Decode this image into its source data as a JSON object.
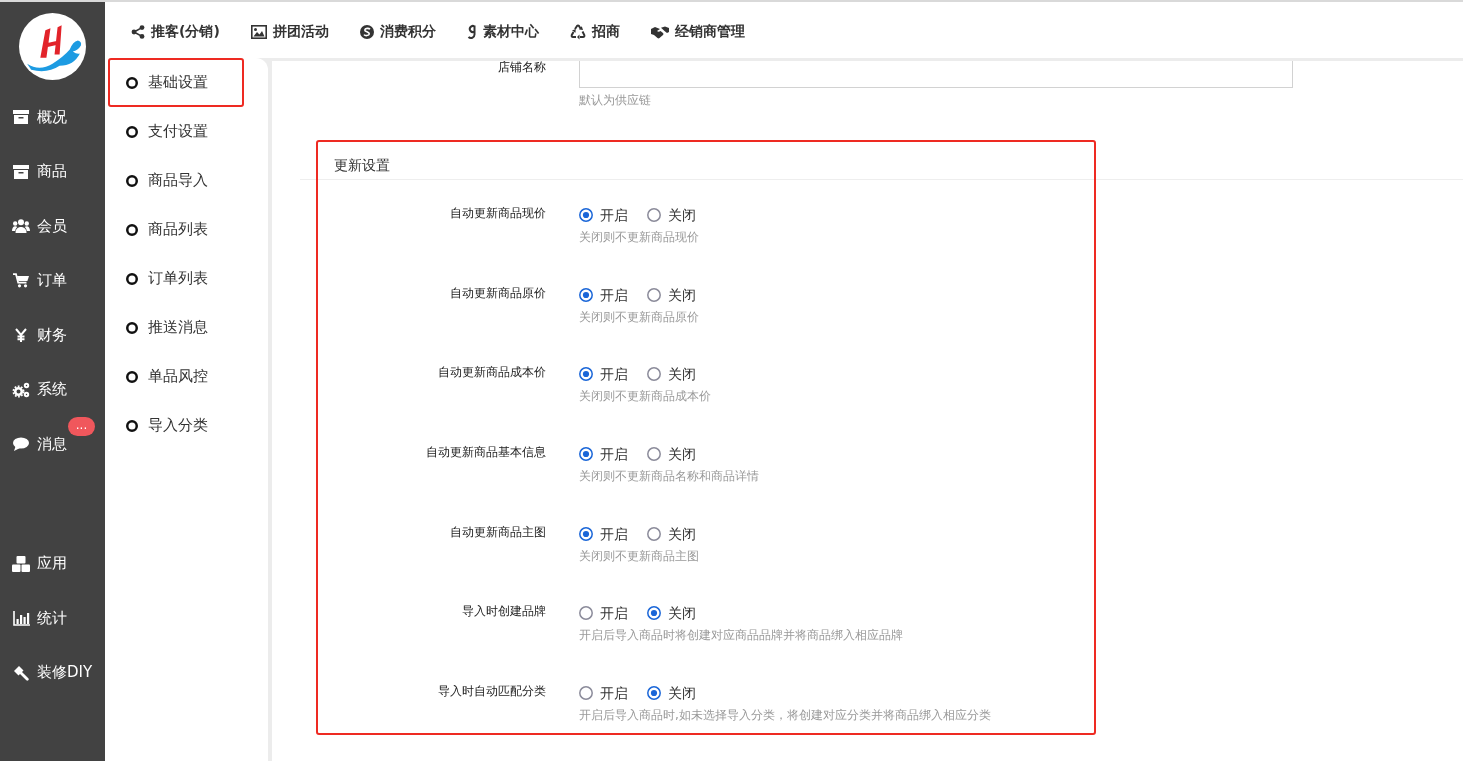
{
  "sidebar": {
    "main_items": [
      {
        "label": "概况"
      },
      {
        "label": "商品"
      },
      {
        "label": "会员"
      },
      {
        "label": "订单"
      },
      {
        "label": "财务"
      },
      {
        "label": "系统"
      },
      {
        "label": "消息",
        "badge": "..."
      }
    ],
    "bottom_items": [
      {
        "label": "应用"
      },
      {
        "label": "统计"
      },
      {
        "label": "装修DIY"
      }
    ]
  },
  "top_nav": [
    {
      "label": "推客(分销)"
    },
    {
      "label": "拼团活动"
    },
    {
      "label": "消费积分"
    },
    {
      "label": "素材中心"
    },
    {
      "label": "招商"
    },
    {
      "label": "经销商管理"
    }
  ],
  "sub_menu": [
    {
      "label": "基础设置",
      "selected": true
    },
    {
      "label": "支付设置",
      "selected": false
    },
    {
      "label": "商品导入",
      "selected": false
    },
    {
      "label": "商品列表",
      "selected": false
    },
    {
      "label": "订单列表",
      "selected": false
    },
    {
      "label": "推送消息",
      "selected": false
    },
    {
      "label": "单品风控",
      "selected": false
    },
    {
      "label": "导入分类",
      "selected": false
    }
  ],
  "store_name": {
    "label": "店铺名称",
    "hint": "默认为供应链"
  },
  "update_section": {
    "title": "更新设置",
    "highlighted": true,
    "rows": [
      {
        "label": "自动更新商品现价",
        "options": [
          {
            "label": "开启",
            "selected": true
          },
          {
            "label": "关闭",
            "selected": false
          }
        ],
        "hint": "关闭则不更新商品现价"
      },
      {
        "label": "自动更新商品原价",
        "options": [
          {
            "label": "开启",
            "selected": true
          },
          {
            "label": "关闭",
            "selected": false
          }
        ],
        "hint": "关闭则不更新商品原价"
      },
      {
        "label": "自动更新商品成本价",
        "options": [
          {
            "label": "开启",
            "selected": true
          },
          {
            "label": "关闭",
            "selected": false
          }
        ],
        "hint": "关闭则不更新商品成本价"
      },
      {
        "label": "自动更新商品基本信息",
        "options": [
          {
            "label": "开启",
            "selected": true
          },
          {
            "label": "关闭",
            "selected": false
          }
        ],
        "hint": "关闭则不更新商品名称和商品详情"
      },
      {
        "label": "自动更新商品主图",
        "options": [
          {
            "label": "开启",
            "selected": true
          },
          {
            "label": "关闭",
            "selected": false
          }
        ],
        "hint": "关闭则不更新商品主图"
      },
      {
        "label": "导入时创建品牌",
        "options": [
          {
            "label": "开启",
            "selected": false
          },
          {
            "label": "关闭",
            "selected": true
          }
        ],
        "hint": "开启后导入商品时将创建对应商品品牌并将商品绑入相应品牌"
      },
      {
        "label": "导入时自动匹配分类",
        "options": [
          {
            "label": "开启",
            "selected": false
          },
          {
            "label": "关闭",
            "selected": true
          }
        ],
        "hint": "开启后导入商品时,如未选择导入分类，将创建对应分类并将商品绑入相应分类"
      }
    ]
  }
}
